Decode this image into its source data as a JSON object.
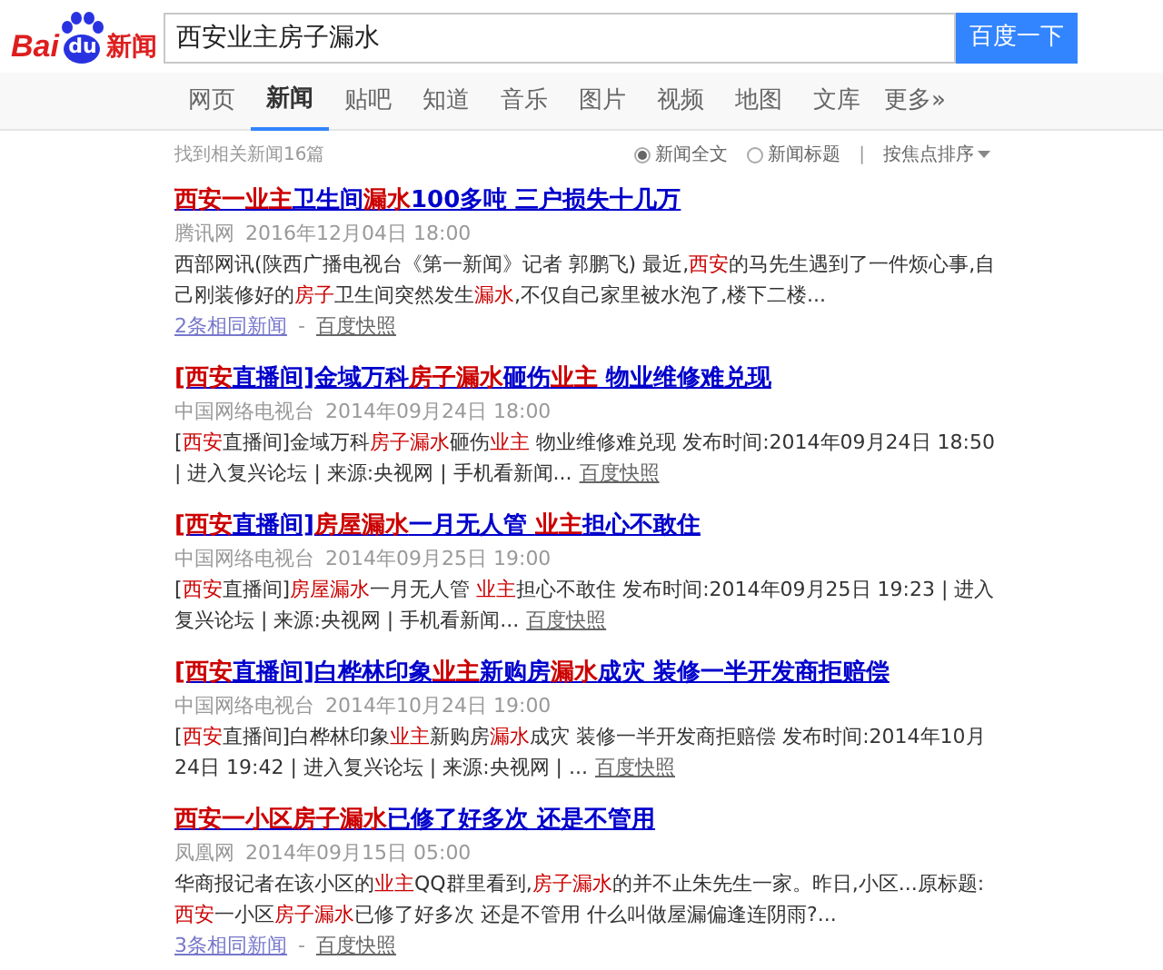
{
  "logo": {
    "left": "Bai",
    "paw": "du",
    "right": "新闻"
  },
  "search": {
    "value": "西安业主房子漏水",
    "button": "百度一下"
  },
  "tabs": [
    {
      "label": "网页",
      "selected": false
    },
    {
      "label": "新闻",
      "selected": true
    },
    {
      "label": "贴吧",
      "selected": false
    },
    {
      "label": "知道",
      "selected": false
    },
    {
      "label": "音乐",
      "selected": false
    },
    {
      "label": "图片",
      "selected": false
    },
    {
      "label": "视频",
      "selected": false
    },
    {
      "label": "地图",
      "selected": false
    },
    {
      "label": "文库",
      "selected": false
    },
    {
      "label": "更多»",
      "selected": false
    }
  ],
  "result_count": "找到相关新闻16篇",
  "filters": [
    {
      "label": "新闻全文",
      "selected": true
    },
    {
      "label": "新闻标题",
      "selected": false
    }
  ],
  "filter_separator": "|",
  "sort": "按焦点排序",
  "results": [
    {
      "title": [
        {
          "text": "西安一业主",
          "highlight": true
        },
        {
          "text": "卫生间",
          "highlight": false
        },
        {
          "text": "漏水",
          "highlight": true
        },
        {
          "text": "100多吨 三户损失十几万",
          "highlight": false
        }
      ],
      "source": "腾讯网",
      "time": "2016年12月04日 18:00",
      "snippet": [
        {
          "text": "西部网讯(陕西广播电视台《第一新闻》记者 郭鹏飞) 最近,",
          "highlight": false
        },
        {
          "text": "西安",
          "highlight": true
        },
        {
          "text": "的马先生遇到了一件烦心事,自己刚装修好的",
          "highlight": false
        },
        {
          "text": "房子",
          "highlight": true
        },
        {
          "text": "卫生间突然发生",
          "highlight": false
        },
        {
          "text": "漏水",
          "highlight": true
        },
        {
          "text": ",不仅自己家里被水泡了,楼下二楼...",
          "highlight": false
        }
      ],
      "related": "2条相同新闻",
      "separator": "-",
      "snapshot": "百度快照"
    },
    {
      "title": [
        {
          "text": "[西安",
          "highlight": true
        },
        {
          "text": "直播间]金域万科",
          "highlight": false
        },
        {
          "text": "房子漏水",
          "highlight": true
        },
        {
          "text": "砸伤",
          "highlight": false
        },
        {
          "text": "业主",
          "highlight": true
        },
        {
          "text": " 物业维修难兑现",
          "highlight": false
        }
      ],
      "source": "中国网络电视台",
      "time": "2014年09月24日 18:00",
      "snippet": [
        {
          "text": "[",
          "highlight": false
        },
        {
          "text": "西安",
          "highlight": true
        },
        {
          "text": "直播间]金域万科",
          "highlight": false
        },
        {
          "text": "房子漏水",
          "highlight": true
        },
        {
          "text": "砸伤",
          "highlight": false
        },
        {
          "text": "业主",
          "highlight": true
        },
        {
          "text": " 物业维修难兑现 发布时间:2014年09月24日 18:50 | 进入复兴论坛 | 来源:央视网 | 手机看新闻...",
          "highlight": false
        }
      ],
      "snapshot": "百度快照"
    },
    {
      "title": [
        {
          "text": "[西安",
          "highlight": true
        },
        {
          "text": "直播间]",
          "highlight": false
        },
        {
          "text": "房屋漏水",
          "highlight": true
        },
        {
          "text": "一月无人管 ",
          "highlight": false
        },
        {
          "text": "业主",
          "highlight": true
        },
        {
          "text": "担心不敢住",
          "highlight": false
        }
      ],
      "source": "中国网络电视台",
      "time": "2014年09月25日 19:00",
      "snippet": [
        {
          "text": "[",
          "highlight": false
        },
        {
          "text": "西安",
          "highlight": true
        },
        {
          "text": "直播间]",
          "highlight": false
        },
        {
          "text": "房屋漏水",
          "highlight": true
        },
        {
          "text": "一月无人管 ",
          "highlight": false
        },
        {
          "text": "业主",
          "highlight": true
        },
        {
          "text": "担心不敢住 发布时间:2014年09月25日 19:23 | 进入复兴论坛 | 来源:央视网 | 手机看新闻...",
          "highlight": false
        }
      ],
      "snapshot": "百度快照"
    },
    {
      "title": [
        {
          "text": "[西安",
          "highlight": true
        },
        {
          "text": "直播间]白桦林印象",
          "highlight": false
        },
        {
          "text": "业主",
          "highlight": true
        },
        {
          "text": "新购房",
          "highlight": false
        },
        {
          "text": "漏水",
          "highlight": true
        },
        {
          "text": "成灾 装修一半开发商拒赔偿",
          "highlight": false
        }
      ],
      "source": "中国网络电视台",
      "time": "2014年10月24日 19:00",
      "snippet": [
        {
          "text": "[",
          "highlight": false
        },
        {
          "text": "西安",
          "highlight": true
        },
        {
          "text": "直播间]白桦林印象",
          "highlight": false
        },
        {
          "text": "业主",
          "highlight": true
        },
        {
          "text": "新购房",
          "highlight": false
        },
        {
          "text": "漏水",
          "highlight": true
        },
        {
          "text": "成灾 装修一半开发商拒赔偿 发布时间:2014年10月24日 19:42 | 进入复兴论坛 | 来源:央视网 | ...",
          "highlight": false
        }
      ],
      "snapshot": "百度快照"
    },
    {
      "title": [
        {
          "text": "西安一小区",
          "highlight": true
        },
        {
          "text": "房子漏水",
          "highlight": true
        },
        {
          "text": "已修了好多次 还是不管用",
          "highlight": false
        }
      ],
      "source": "凤凰网",
      "time": "2014年09月15日 05:00",
      "snippet": [
        {
          "text": "华商报记者在该小区的",
          "highlight": false
        },
        {
          "text": "业主",
          "highlight": true
        },
        {
          "text": "QQ群里看到,",
          "highlight": false
        },
        {
          "text": "房子漏水",
          "highlight": true
        },
        {
          "text": "的并不止朱先生一家。昨日,小区...原标题:",
          "highlight": false
        },
        {
          "text": "西安",
          "highlight": true
        },
        {
          "text": "一小区",
          "highlight": false
        },
        {
          "text": "房子漏水",
          "highlight": true
        },
        {
          "text": "已修了好多次 还是不管用 什么叫做屋漏偏逢连阴雨?...",
          "highlight": false
        }
      ],
      "related": "3条相同新闻",
      "separator": "-",
      "snapshot": "百度快照"
    }
  ]
}
